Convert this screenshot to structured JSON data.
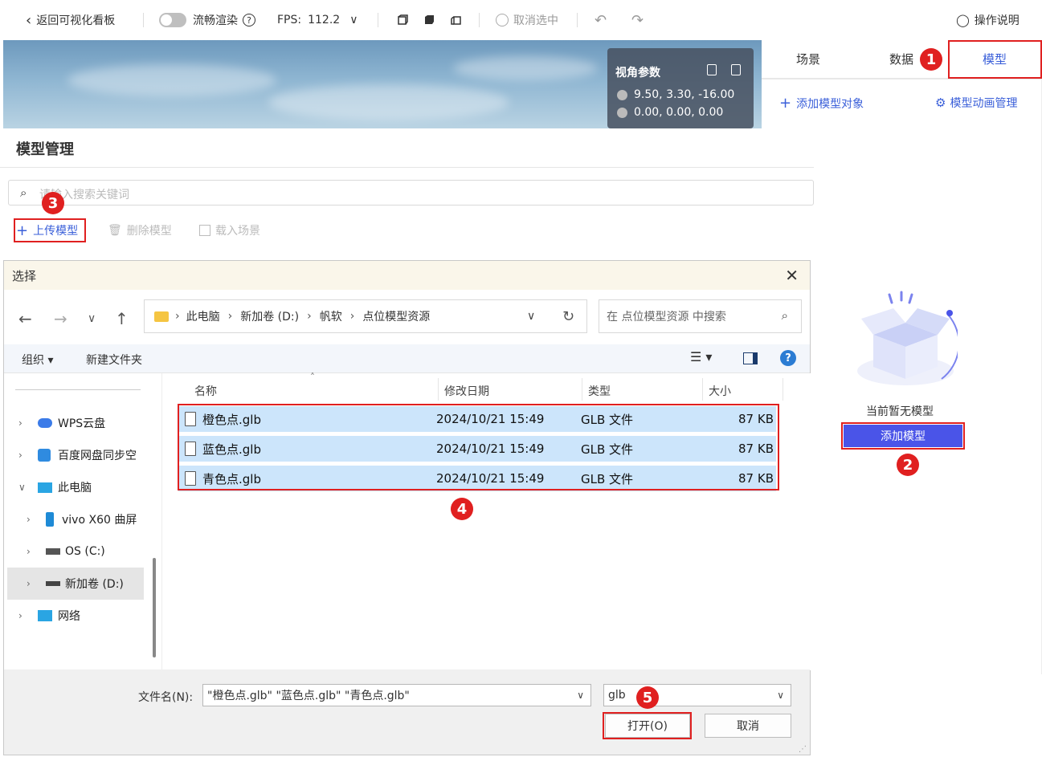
{
  "topbar": {
    "back_label": "返回可视化看板",
    "smooth_label": "流畅渲染",
    "fps_label": "FPS:",
    "fps_value": "112.2",
    "deselect_label": "取消选中",
    "help_label": "操作说明"
  },
  "viewport": {
    "title": "视角参数",
    "camera": "9.50, 3.30, -16.00",
    "target": "0.00, 0.00, 0.00"
  },
  "right_panel": {
    "tabs": [
      "场景",
      "数据",
      "模型"
    ],
    "active_tab": "模型",
    "add_object_label": "添加模型对象",
    "anim_manage_label": "模型动画管理",
    "empty_text": "当前暂无模型",
    "add_model_label": "添加模型"
  },
  "model_manage": {
    "title": "模型管理",
    "search_placeholder": "请输入搜索关键词",
    "upload_label": "上传模型",
    "delete_label": "删除模型",
    "load_label": "载入场景"
  },
  "dialog": {
    "title": "选择",
    "path": [
      "此电脑",
      "新加卷 (D:)",
      "帆软",
      "点位模型资源"
    ],
    "search_placeholder": "在 点位模型资源 中搜索",
    "organize_label": "组织 ▾",
    "new_folder_label": "新建文件夹",
    "tree": [
      "WPS云盘",
      "百度网盘同步空",
      "此电脑",
      "vivo X60 曲屏",
      "OS (C:)",
      "新加卷 (D:)",
      "网络"
    ],
    "columns": [
      "名称",
      "修改日期",
      "类型",
      "大小"
    ],
    "files": [
      {
        "name": "橙色点.glb",
        "date": "2024/10/21 15:49",
        "type": "GLB 文件",
        "size": "87 KB"
      },
      {
        "name": "蓝色点.glb",
        "date": "2024/10/21 15:49",
        "type": "GLB 文件",
        "size": "87 KB"
      },
      {
        "name": "青色点.glb",
        "date": "2024/10/21 15:49",
        "type": "GLB 文件",
        "size": "87 KB"
      }
    ],
    "filename_label": "文件名(N):",
    "filename_value": "\"橙色点.glb\" \"蓝色点.glb\" \"青色点.glb\"",
    "filter_value": "glb",
    "open_label": "打开(O)",
    "cancel_label": "取消"
  },
  "annotations": [
    "1",
    "2",
    "3",
    "4",
    "5"
  ],
  "colors": {
    "accent": "#3a5fd9",
    "highlight_red": "#e02020",
    "selected_row": "#cce5fb",
    "add_model_btn": "#4a54e8"
  }
}
